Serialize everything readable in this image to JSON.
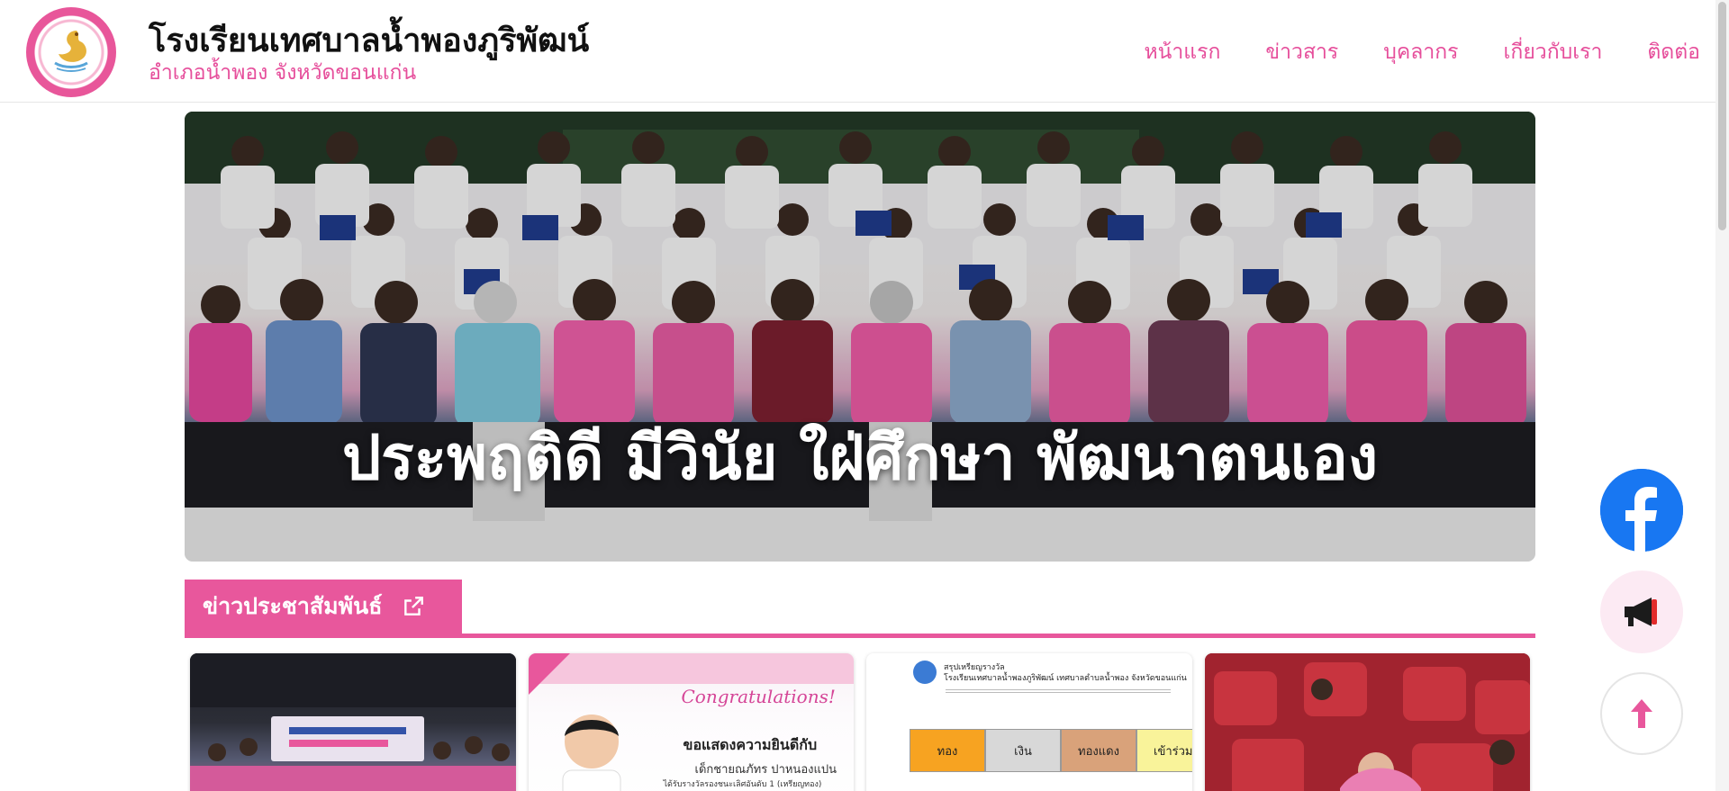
{
  "header": {
    "logo_name": "school-logo",
    "school_name": "โรงเรียนเทศบาลน้ำพองภูริพัฒน์",
    "school_location": "อำเภอน้ำพอง จังหวัดขอนแก่น"
  },
  "nav": {
    "items": [
      {
        "label": "หน้าแรก"
      },
      {
        "label": "ข่าวสาร"
      },
      {
        "label": "บุคลากร"
      },
      {
        "label": "เกี่ยวกับเรา"
      },
      {
        "label": "ติดต่อ"
      }
    ]
  },
  "hero": {
    "motto": "ประพฤติดี มีวินัย ใฝ่ศึกษา พัฒนาตนเอง"
  },
  "news_section": {
    "title": "ข่าวประชาสัมพันธ์",
    "link_icon": "external-link-icon"
  },
  "cards": [
    {
      "name": "news-card-1",
      "text": ""
    },
    {
      "name": "news-card-2",
      "banner": "Congratulations!",
      "line1": "ขอแสดงความยินดีกับ",
      "line2": "เด็กชายณภัทร ปาหนองแปน",
      "line3": "ได้รับรางวัลรองชนะเลิศอันดับ 1 (เหรียญทอง)"
    },
    {
      "name": "news-card-3",
      "heading1": "สรุปเหรียญรางวัล",
      "heading2": "โรงเรียนเทศบาลน้ำพองภูริพัฒน์ เทศบาลตำบลน้ำพอง จังหวัดขอนแก่น",
      "medals": [
        "ทอง",
        "เงิน",
        "ทองแดง",
        "เข้าร่วม"
      ]
    },
    {
      "name": "news-card-4",
      "text": ""
    }
  ],
  "floating": {
    "facebook": "facebook-icon",
    "announce": "megaphone-icon",
    "top": "arrow-up-icon"
  },
  "colors": {
    "accent": "#e8579c",
    "nav_text": "#e64e9b",
    "facebook": "#1877f2"
  }
}
